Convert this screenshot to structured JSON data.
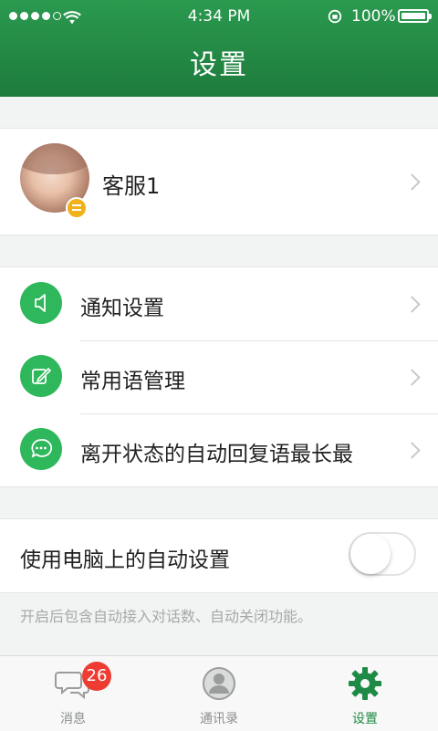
{
  "status_bar": {
    "time": "4:34 PM",
    "battery": "100%",
    "signal_bars_filled": 4,
    "signal_bars_total": 5
  },
  "header": {
    "title": "设置"
  },
  "profile": {
    "name": "客服1",
    "avatar_badge_icon": "menu-badge-icon"
  },
  "menu": {
    "items": [
      {
        "label": "通知设置",
        "icon": "speaker-icon"
      },
      {
        "label": "常用语管理",
        "icon": "edit-icon"
      },
      {
        "label": "离开状态的自动回复语最长最",
        "icon": "chat-bubble-icon"
      }
    ]
  },
  "auto_setting": {
    "label": "使用电脑上的自动设置",
    "enabled": false,
    "hint": "开启后包含自动接入对话数、自动关闭功能。"
  },
  "tabbar": {
    "tabs": [
      {
        "label": "消息",
        "icon": "messages-icon",
        "badge": "26"
      },
      {
        "label": "通讯录",
        "icon": "contacts-icon"
      },
      {
        "label": "设置",
        "icon": "gear-icon"
      }
    ],
    "active_index": 2
  },
  "colors": {
    "header_green": "#1e7b3c",
    "icon_green": "#2fb85b",
    "badge_red": "#ee3c33",
    "badge_yellow": "#f0b218"
  }
}
